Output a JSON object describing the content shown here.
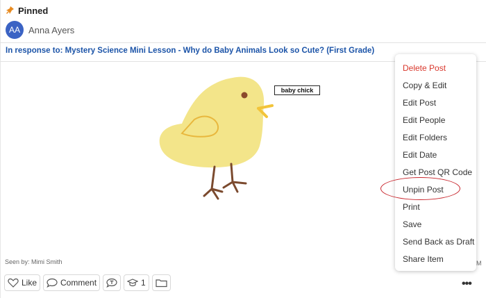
{
  "post": {
    "pinned_label": "Pinned",
    "author_initials": "AA",
    "author_name": "Anna Ayers",
    "response_text": "In response to: Mystery Science Mini Lesson - Why do Baby Animals Look so Cute? (First Grade)",
    "drawing_label": "baby chick",
    "seen_by": "Seen by: Mimi Smith",
    "trunc_right": "M"
  },
  "actions": {
    "like_label": "Like",
    "comment_label": "Comment",
    "level_count": "1"
  },
  "menu": {
    "items": [
      "Delete Post",
      "Copy & Edit",
      "Edit Post",
      "Edit People",
      "Edit Folders",
      "Edit Date",
      "Get Post QR Code",
      "Unpin Post",
      "Print",
      "Save",
      "Send Back as Draft",
      "Share Item"
    ]
  },
  "colors": {
    "accent_blue": "#1c54a8",
    "avatar_blue": "#3b63c4",
    "danger_red": "#d9372c",
    "highlight_red": "#c8252c",
    "chick_yellow": "#f3e58a"
  },
  "icons": {
    "pinned": "pushpin-icon",
    "like": "heart-icon",
    "comment": "speech-bubble-icon",
    "translate": "translate-icon",
    "level": "graduation-cap-icon",
    "folder": "folder-icon",
    "more": "more-horizontal-icon"
  }
}
